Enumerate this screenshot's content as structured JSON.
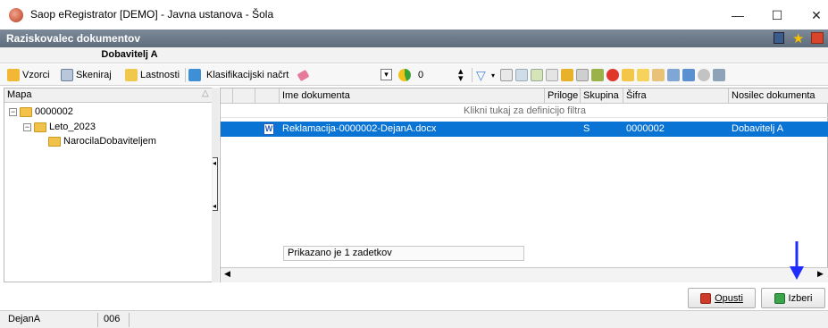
{
  "window": {
    "title": "Saop eRegistrator [DEMO] - Javna ustanova - Šola",
    "minimize_glyph": "—",
    "maximize_glyph": "☐",
    "close_glyph": "✕"
  },
  "header": {
    "title": "Raziskovalec dokumentov",
    "subtitle": "Dobavitelj A"
  },
  "toolbar": {
    "vzorci_label": "Vzorci",
    "skeniraj_label": "Skeniraj",
    "lastnosti_label": "Lastnosti",
    "klasifikacija_label": "Klasifikacijski načrt",
    "counter_value": "0"
  },
  "tree": {
    "header": "Mapa",
    "nodes": [
      {
        "label": "0000002",
        "level": 0,
        "expander": "−"
      },
      {
        "label": "Leto_2023",
        "level": 1,
        "expander": "−"
      },
      {
        "label": "NarocilaDobaviteljem",
        "level": 2,
        "expander": ""
      }
    ]
  },
  "grid": {
    "columns": [
      "Ime dokumenta",
      "Priloge",
      "Skupina",
      "Šifra",
      "Nosilec dokumenta"
    ],
    "filter_hint": "Klikni tukaj za definicijo filtra",
    "rows": [
      {
        "name": "Reklamacija-0000002-DejanA.docx",
        "priloge": "",
        "skupina": "S",
        "sifra": "0000002",
        "nosilec": "Dobavitelj A"
      }
    ],
    "status": "Prikazano je 1 zadetkov"
  },
  "buttons": {
    "cancel": "Opusti",
    "select": "Izberi"
  },
  "statusbar": {
    "user": "DejanA",
    "code": "006"
  },
  "colors": {
    "selection": "#0a74d5",
    "header_bg": "#6e7b8b",
    "annotation_arrow": "#1f2bff"
  }
}
